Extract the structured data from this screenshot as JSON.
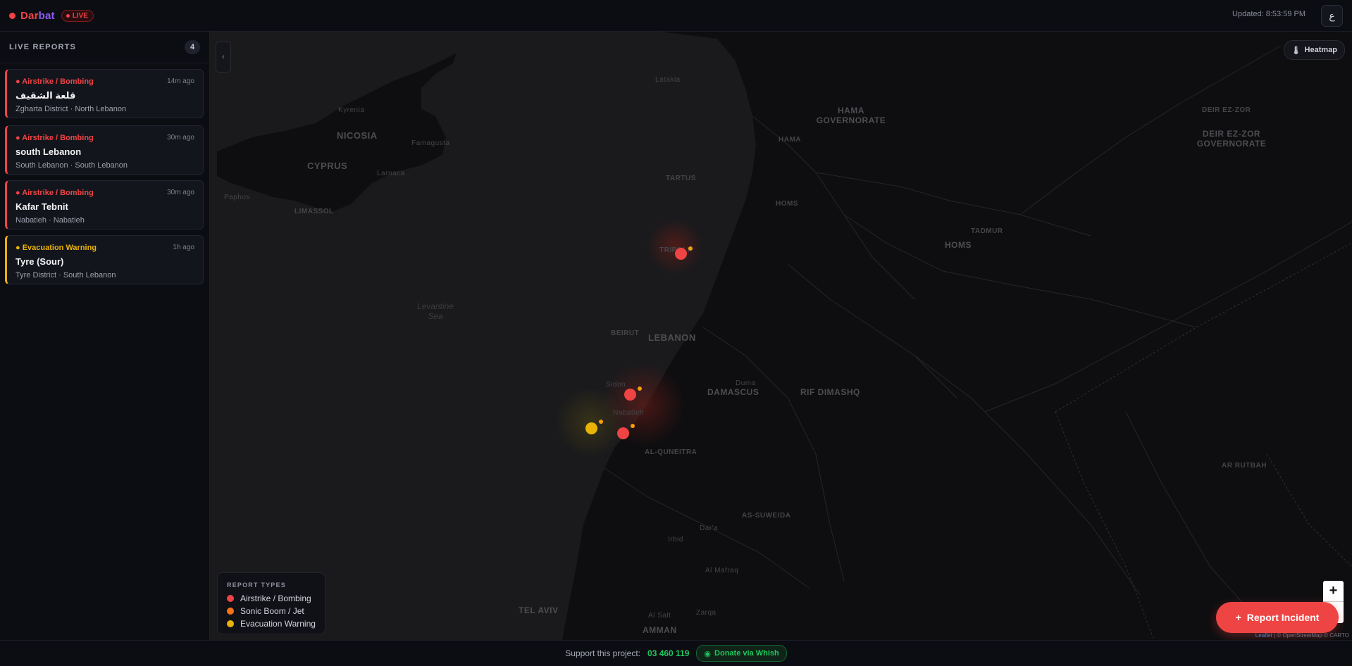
{
  "header": {
    "brand_part1": "Dar",
    "brand_part2": "bat",
    "live_label": "LIVE",
    "updated": "Updated: 8:53:59 PM",
    "lang_toggle": "ع"
  },
  "sidebar": {
    "title": "LIVE REPORTS",
    "count": "4",
    "reports": [
      {
        "type": "Airstrike / Bombing",
        "time": "14m ago",
        "title": "قلعة الشقيف",
        "location": "Zgharta District · North Lebanon"
      },
      {
        "type": "Airstrike / Bombing",
        "time": "30m ago",
        "title": "south Lebanon",
        "location": "South Lebanon · South Lebanon"
      },
      {
        "type": "Airstrike / Bombing",
        "time": "30m ago",
        "title": "Kafar Tebnit",
        "location": "Nabatieh · Nabatieh"
      },
      {
        "type": "Evacuation Warning",
        "time": "1h ago",
        "title": "Tyre (Sour)",
        "location": "Tyre District · South Lebanon"
      }
    ]
  },
  "map": {
    "collapse_icon": "‹",
    "heatmap_label": "Heatmap",
    "labels": {
      "nicosia": "NICOSIA",
      "cyprus": "CYPRUS",
      "limassol": "LIMASSOL",
      "kyrenia": "Kyrenia",
      "famagusta": "Famagusta",
      "larnaca": "Larnaca",
      "paphos": "Paphos",
      "levantine_sea": "Levantine Sea",
      "latakia": "Latakia",
      "hama_gov": "HAMA GOVERNORATE",
      "hama": "HAMA",
      "tartus": "TARTUS",
      "homs_city": "HOMS",
      "homs_region": "HOMS",
      "tadmur": "TADMUR",
      "deir_city": "DEIR EZ-ZOR",
      "deir_gov": "DEIR EZ-ZOR GOVERNORATE",
      "tripoli": "TRIPOLI",
      "beirut": "BEIRUT",
      "lebanon": "LEBANON",
      "damascus": "DAMASCUS",
      "duma": "Duma",
      "rif_dimashq": "RIF DIMASHQ",
      "sidon": "Sidon",
      "nabatieh": "Nabatieh",
      "al_quneitra": "AL-QUNEITRA",
      "as_suweida": "AS-SUWEIDA",
      "ar_rutbah": "AR RUTBAH",
      "dara": "Dar'a",
      "irbid": "Irbid",
      "al_mafraq": "Al Mafraq",
      "tel_aviv": "TEL AVIV",
      "al_salt": "Al Salt",
      "zarqa": "Zarqa",
      "amman": "AMMAN"
    },
    "zoom_in": "+",
    "report_button": "Report Incident",
    "report_icon": "+",
    "attribution_leaflet": "Leaflet",
    "attribution_rest": " | © OpenStreetMap © CARTO"
  },
  "legend": {
    "title": "REPORT TYPES",
    "items": [
      {
        "label": "Airstrike / Bombing",
        "color": "#ef4444"
      },
      {
        "label": "Sonic Boom / Jet",
        "color": "#f97316"
      },
      {
        "label": "Evacuation Warning",
        "color": "#eab308"
      }
    ]
  },
  "footer": {
    "support_text": "Support this project:",
    "phone": "03 460 119",
    "donate_label": "Donate via Whish"
  },
  "colors": {
    "airstrike": "#ef4444",
    "evacuation": "#eab308",
    "accent_green": "#22c55e",
    "brand_purple": "#8b5cf6"
  }
}
